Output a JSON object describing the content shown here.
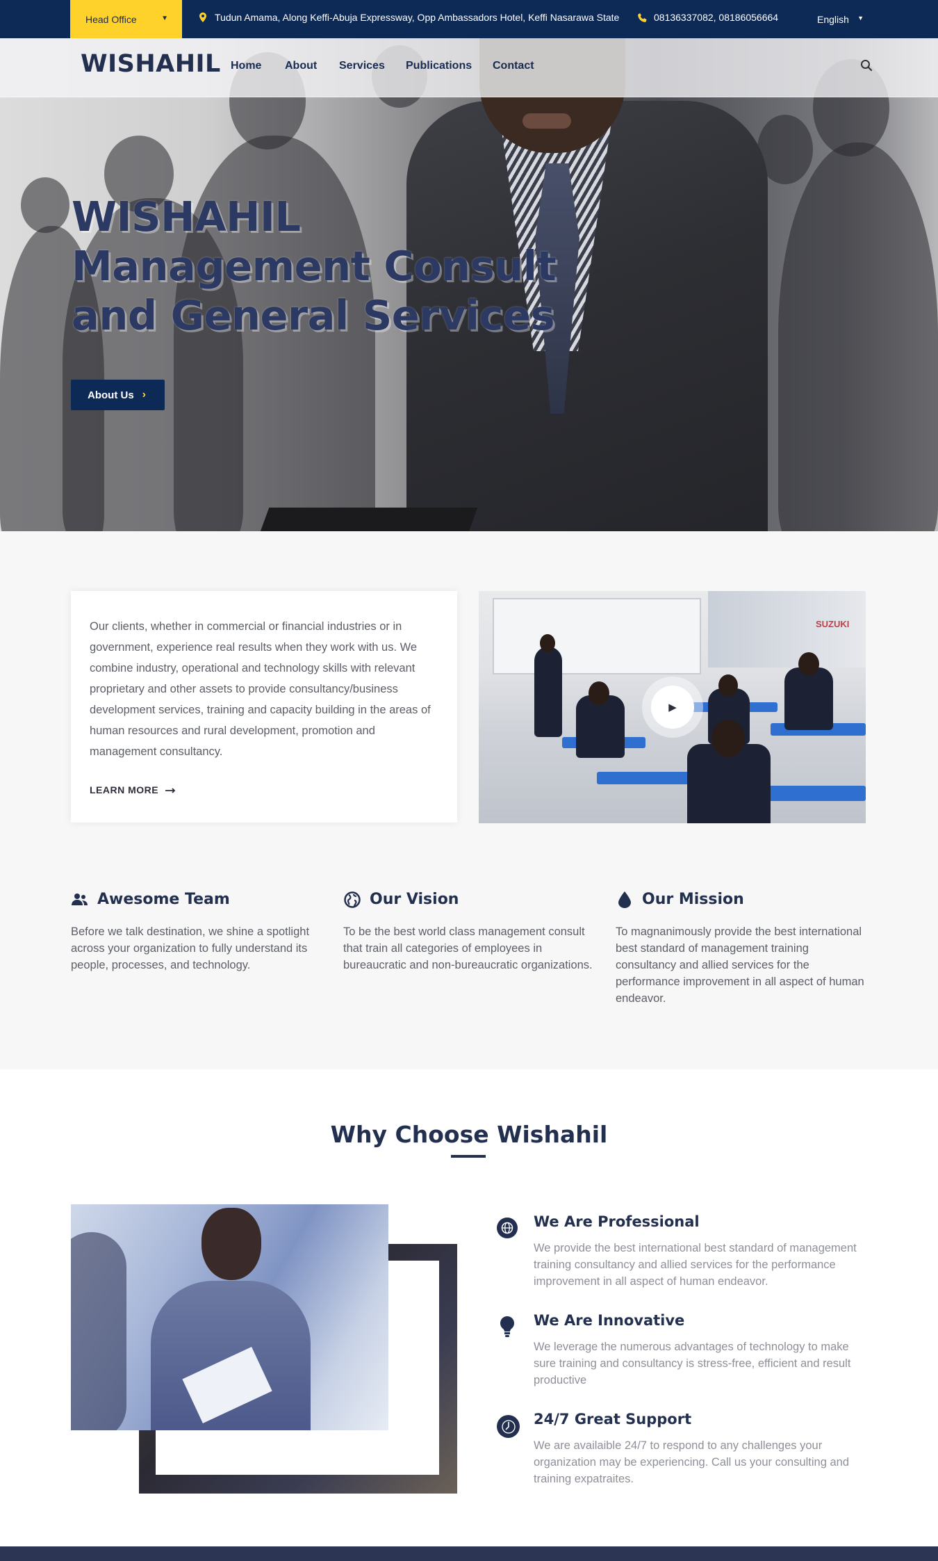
{
  "topbar": {
    "office_label": "Head Office",
    "address": "Tudun Amama, Along Keffi-Abuja Expressway, Opp Ambassadors Hotel, Keffi Nasarawa State",
    "phones": "08136337082, 08186056664",
    "language": "English",
    "accent_color": "#fed22a",
    "bar_color": "#0d2a57"
  },
  "header": {
    "logo": "WISHAHIL",
    "nav": [
      "Home",
      "About",
      "Services",
      "Publications",
      "Contact"
    ],
    "search_icon": "search-icon"
  },
  "hero": {
    "title_lines": [
      "WISHAHIL",
      "Management Consult",
      "and General Services"
    ],
    "button_label": "About Us"
  },
  "intro": {
    "text": "Our clients, whether in commercial or financial industries or in government, experience real results when they work with us. We combine industry, operational and technology skills with relevant proprietary and other assets to provide consultancy/business development services, training and capacity building in the areas of human resources and rural development, promotion and management consultancy.",
    "learn_more": "LEARN MORE",
    "video_brand": "SUZUKI"
  },
  "features": [
    {
      "icon": "team-icon",
      "title": "Awesome Team",
      "text": "Before we talk destination, we shine a spotlight across your organization to fully understand its people, processes, and technology."
    },
    {
      "icon": "globe-icon",
      "title": "Our Vision",
      "text": "To be the best world class management consult that train all categories of employees in bureaucratic and non-bureaucratic organizations."
    },
    {
      "icon": "drop-icon",
      "title": "Our Mission",
      "text": "To magnanimously provide the best international best standard of management training consultancy and allied services for the performance improvement in all aspect of human endeavor."
    }
  ],
  "why": {
    "title": "Why Choose Wishahil",
    "items": [
      {
        "icon": "globe-icon",
        "title": "We Are Professional",
        "text": "We provide the best international best standard of management training consultancy and allied services for the performance improvement in all aspect of human endeavor."
      },
      {
        "icon": "lightbulb-icon",
        "title": "We Are Innovative",
        "text": "We leverage the numerous advantages of technology to make sure training and consultancy is stress-free, efficient and result productive"
      },
      {
        "icon": "clock-icon",
        "title": "24/7 Great Support",
        "text": "We are availaible 24/7 to respond to any challenges your organization may be experiencing. Call us your consulting and training expatraites."
      }
    ]
  }
}
